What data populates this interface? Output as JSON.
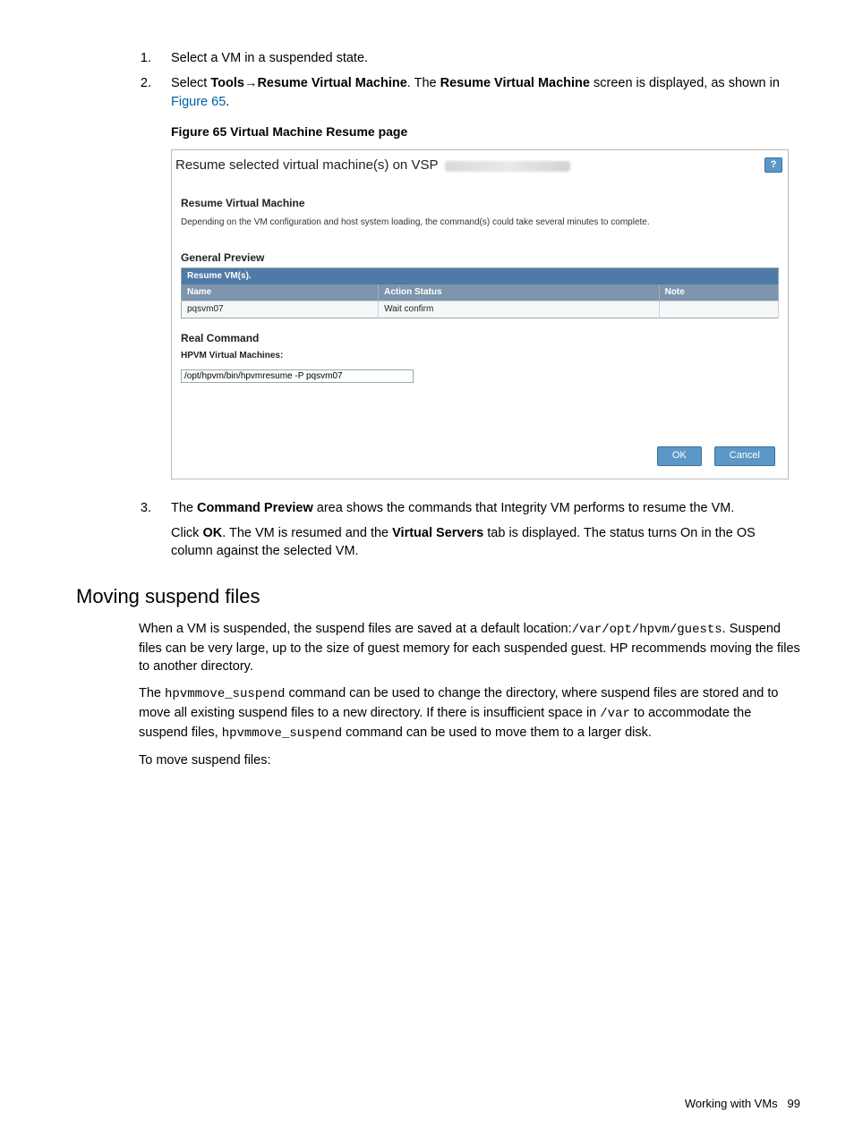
{
  "steps": {
    "s1": "Select a VM in a suspended state.",
    "s2a": "Select ",
    "s2_tools": "Tools",
    "s2_arrow": "→",
    "s2_resume": "Resume Virtual Machine",
    "s2b": ". The ",
    "s2_resume2": "Resume Virtual Machine",
    "s2c": " screen is displayed, as shown in ",
    "s2_link": "Figure 65",
    "s2d": ".",
    "s3a": "The ",
    "s3_cp": "Command Preview",
    "s3b": " area shows the commands that Integrity VM performs to resume the VM.",
    "s3c": "Click ",
    "s3_ok": "OK",
    "s3d": ". The VM is resumed and the ",
    "s3_vs": "Virtual Servers",
    "s3e": " tab is displayed. The status turns On in the OS column against the selected VM."
  },
  "figure_caption": "Figure 65 Virtual Machine Resume page",
  "shot": {
    "header": "Resume selected virtual machine(s) on VSP",
    "resume_title": "Resume Virtual Machine",
    "note": "Depending on the VM configuration and host system loading, the command(s) could take several minutes to complete.",
    "gp_title": "General Preview",
    "tbl_top": "Resume VM(s).",
    "h_name": "Name",
    "h_status": "Action Status",
    "h_note": "Note",
    "row_name": "pqsvm07",
    "row_status": "Wait confirm",
    "row_note": "",
    "rc_title": "Real Command",
    "hpvm_label": "HPVM Virtual Machines:",
    "cmd_value": "/opt/hpvm/bin/hpvmresume -P pqsvm07",
    "ok": "OK",
    "cancel": "Cancel"
  },
  "h2": "Moving suspend files",
  "para1a": "When a VM is suspended, the suspend files are saved at a default location:",
  "para1_code1": "/var/opt/hpvm/guests",
  "para1b": ". Suspend files can be very large, up to the size of guest memory for each suspended guest. HP recommends moving the files to another directory.",
  "para2a": "The ",
  "para2_code1": "hpvmmove_suspend",
  "para2b": " command can be used to change the directory, where suspend files are stored and to move all existing suspend files to a new directory. If there is insufficient space in ",
  "para2_code2": "/var",
  "para2c": " to accommodate the suspend files, ",
  "para2_code3": "hpvmmove_suspend",
  "para2d": " command can be used to move them to a larger disk.",
  "para3": "To move suspend files:",
  "footer_text": "Working with VMs",
  "footer_page": "99"
}
